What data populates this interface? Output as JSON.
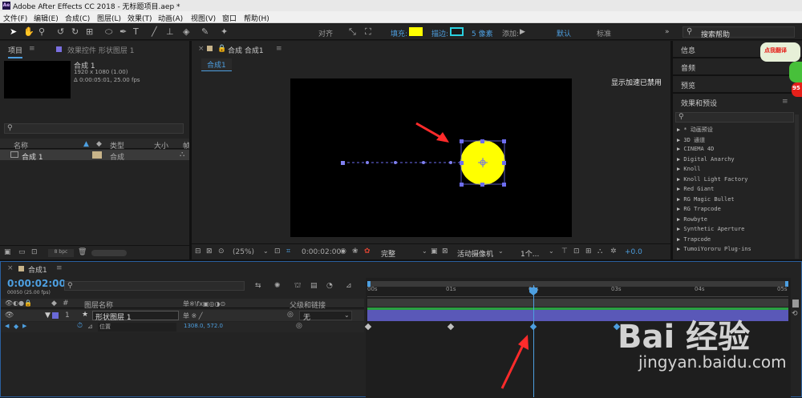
{
  "window": {
    "title": "Adobe After Effects CC 2018 - 无标题项目.aep *",
    "logo": "Ae"
  },
  "menu": [
    "文件(F)",
    "编辑(E)",
    "合成(C)",
    "图层(L)",
    "效果(T)",
    "动画(A)",
    "视图(V)",
    "窗口",
    "帮助(H)"
  ],
  "toolbar": {
    "align": "对齐",
    "fill": "填充:",
    "stroke": "描边:",
    "stroke_width": "5 像素",
    "add": "添加:",
    "workspace_default": "默认",
    "workspace_standard": "标准",
    "search_help": "搜索帮助",
    "fill_color": "#ffff00",
    "stroke_color": "#2ad0e0"
  },
  "project": {
    "tab": "项目",
    "effect_tab": "效果控件 形状图层 1",
    "comp_name": "合成 1",
    "comp_res": "1920 x 1080 (1.00)",
    "comp_dur": "Δ 0:00:05:01, 25.00 fps",
    "col_name": "名称",
    "col_type": "类型",
    "col_size": "大小",
    "col_extra": "帧",
    "row_name": "合成 1",
    "row_type": "合成",
    "bpc": "8 bpc"
  },
  "comp": {
    "tab": "合成 合成1",
    "subtab": "合成1",
    "gpu_msg": "显示加速已禁用",
    "zoom": "(25%)",
    "time": "0:00:02:00",
    "quality": "完整",
    "camera": "活动摄像机",
    "views": "1个...",
    "offset": "+0.0"
  },
  "right": {
    "info": "信息",
    "audio": "音频",
    "preview": "预览",
    "effects": "效果和预设",
    "badge": "点我翻译",
    "badge_num": "95",
    "effects_list": [
      "▶ * 动画预设",
      "▶ 3D 通道",
      "▶ CINEMA 4D",
      "▶ Digital Anarchy",
      "▶ Knoll",
      "▶ Knoll Light Factory",
      "▶ Red Giant",
      "▶ RG Magic Bullet",
      "▶ RG Trapcode",
      "▶ Rowbyte",
      "▶ Synthetic Aperture",
      "▶ Trapcode",
      "▶ TumoiYororu Plug-ins"
    ]
  },
  "timeline": {
    "tab": "合成1",
    "time": "0:00:02:00",
    "frames": "00050 (25.00 fps)",
    "col_layer": "图层名称",
    "col_switches": "单※\\fx▣◎◑⊙",
    "col_parent": "父级和链接",
    "layer_num": "1",
    "layer_name": "形状图层 1",
    "parent_val": "无",
    "prop_name": "位置",
    "prop_val": "1308.0, 572.0",
    "ruler": [
      "00s",
      "01s",
      "02s",
      "03s",
      "04s",
      "05s"
    ],
    "keyframe_times": [
      0,
      1,
      2,
      3
    ]
  },
  "watermark": {
    "brand": "Bai 经验",
    "url": "jingyan.baidu.com"
  }
}
